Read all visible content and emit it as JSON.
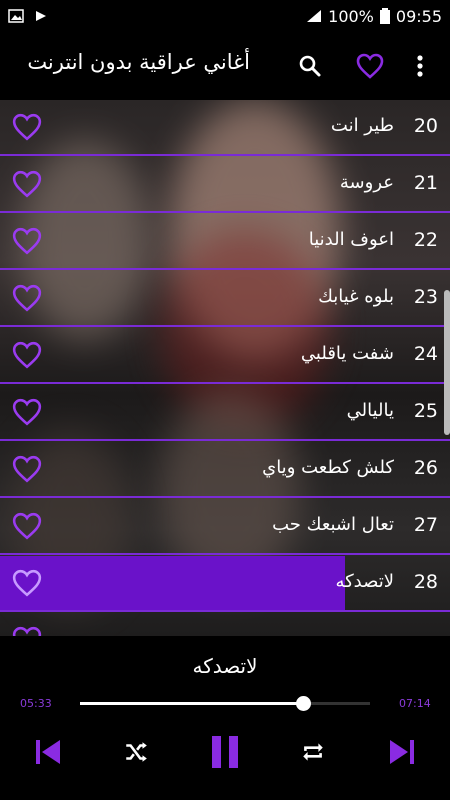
{
  "status": {
    "battery": "100%",
    "time": "09:55"
  },
  "appbar": {
    "title": "أغاني عراقية بدون انترنت"
  },
  "songs": [
    {
      "num": "20",
      "title": "طير انت"
    },
    {
      "num": "21",
      "title": "عروسة"
    },
    {
      "num": "22",
      "title": "اعوف الدنيا"
    },
    {
      "num": "23",
      "title": "بلوه غيابك"
    },
    {
      "num": "24",
      "title": "شفت ياقلبي"
    },
    {
      "num": "25",
      "title": "ياليالي"
    },
    {
      "num": "26",
      "title": "كلش كطعت وياي"
    },
    {
      "num": "27",
      "title": "تعال اشبعك حب"
    },
    {
      "num": "28",
      "title": "لاتصدكه"
    }
  ],
  "player": {
    "now_playing": "لاتصدكه",
    "elapsed": "05:33",
    "duration": "07:14",
    "progress": 0.77
  },
  "colors": {
    "accent": "#8a2be2",
    "active_row": "#6a12c9"
  },
  "icons": [
    "search-icon",
    "heart-icon",
    "more-icon",
    "skip-previous-icon",
    "shuffle-icon",
    "pause-icon",
    "repeat-icon",
    "skip-next-icon"
  ]
}
